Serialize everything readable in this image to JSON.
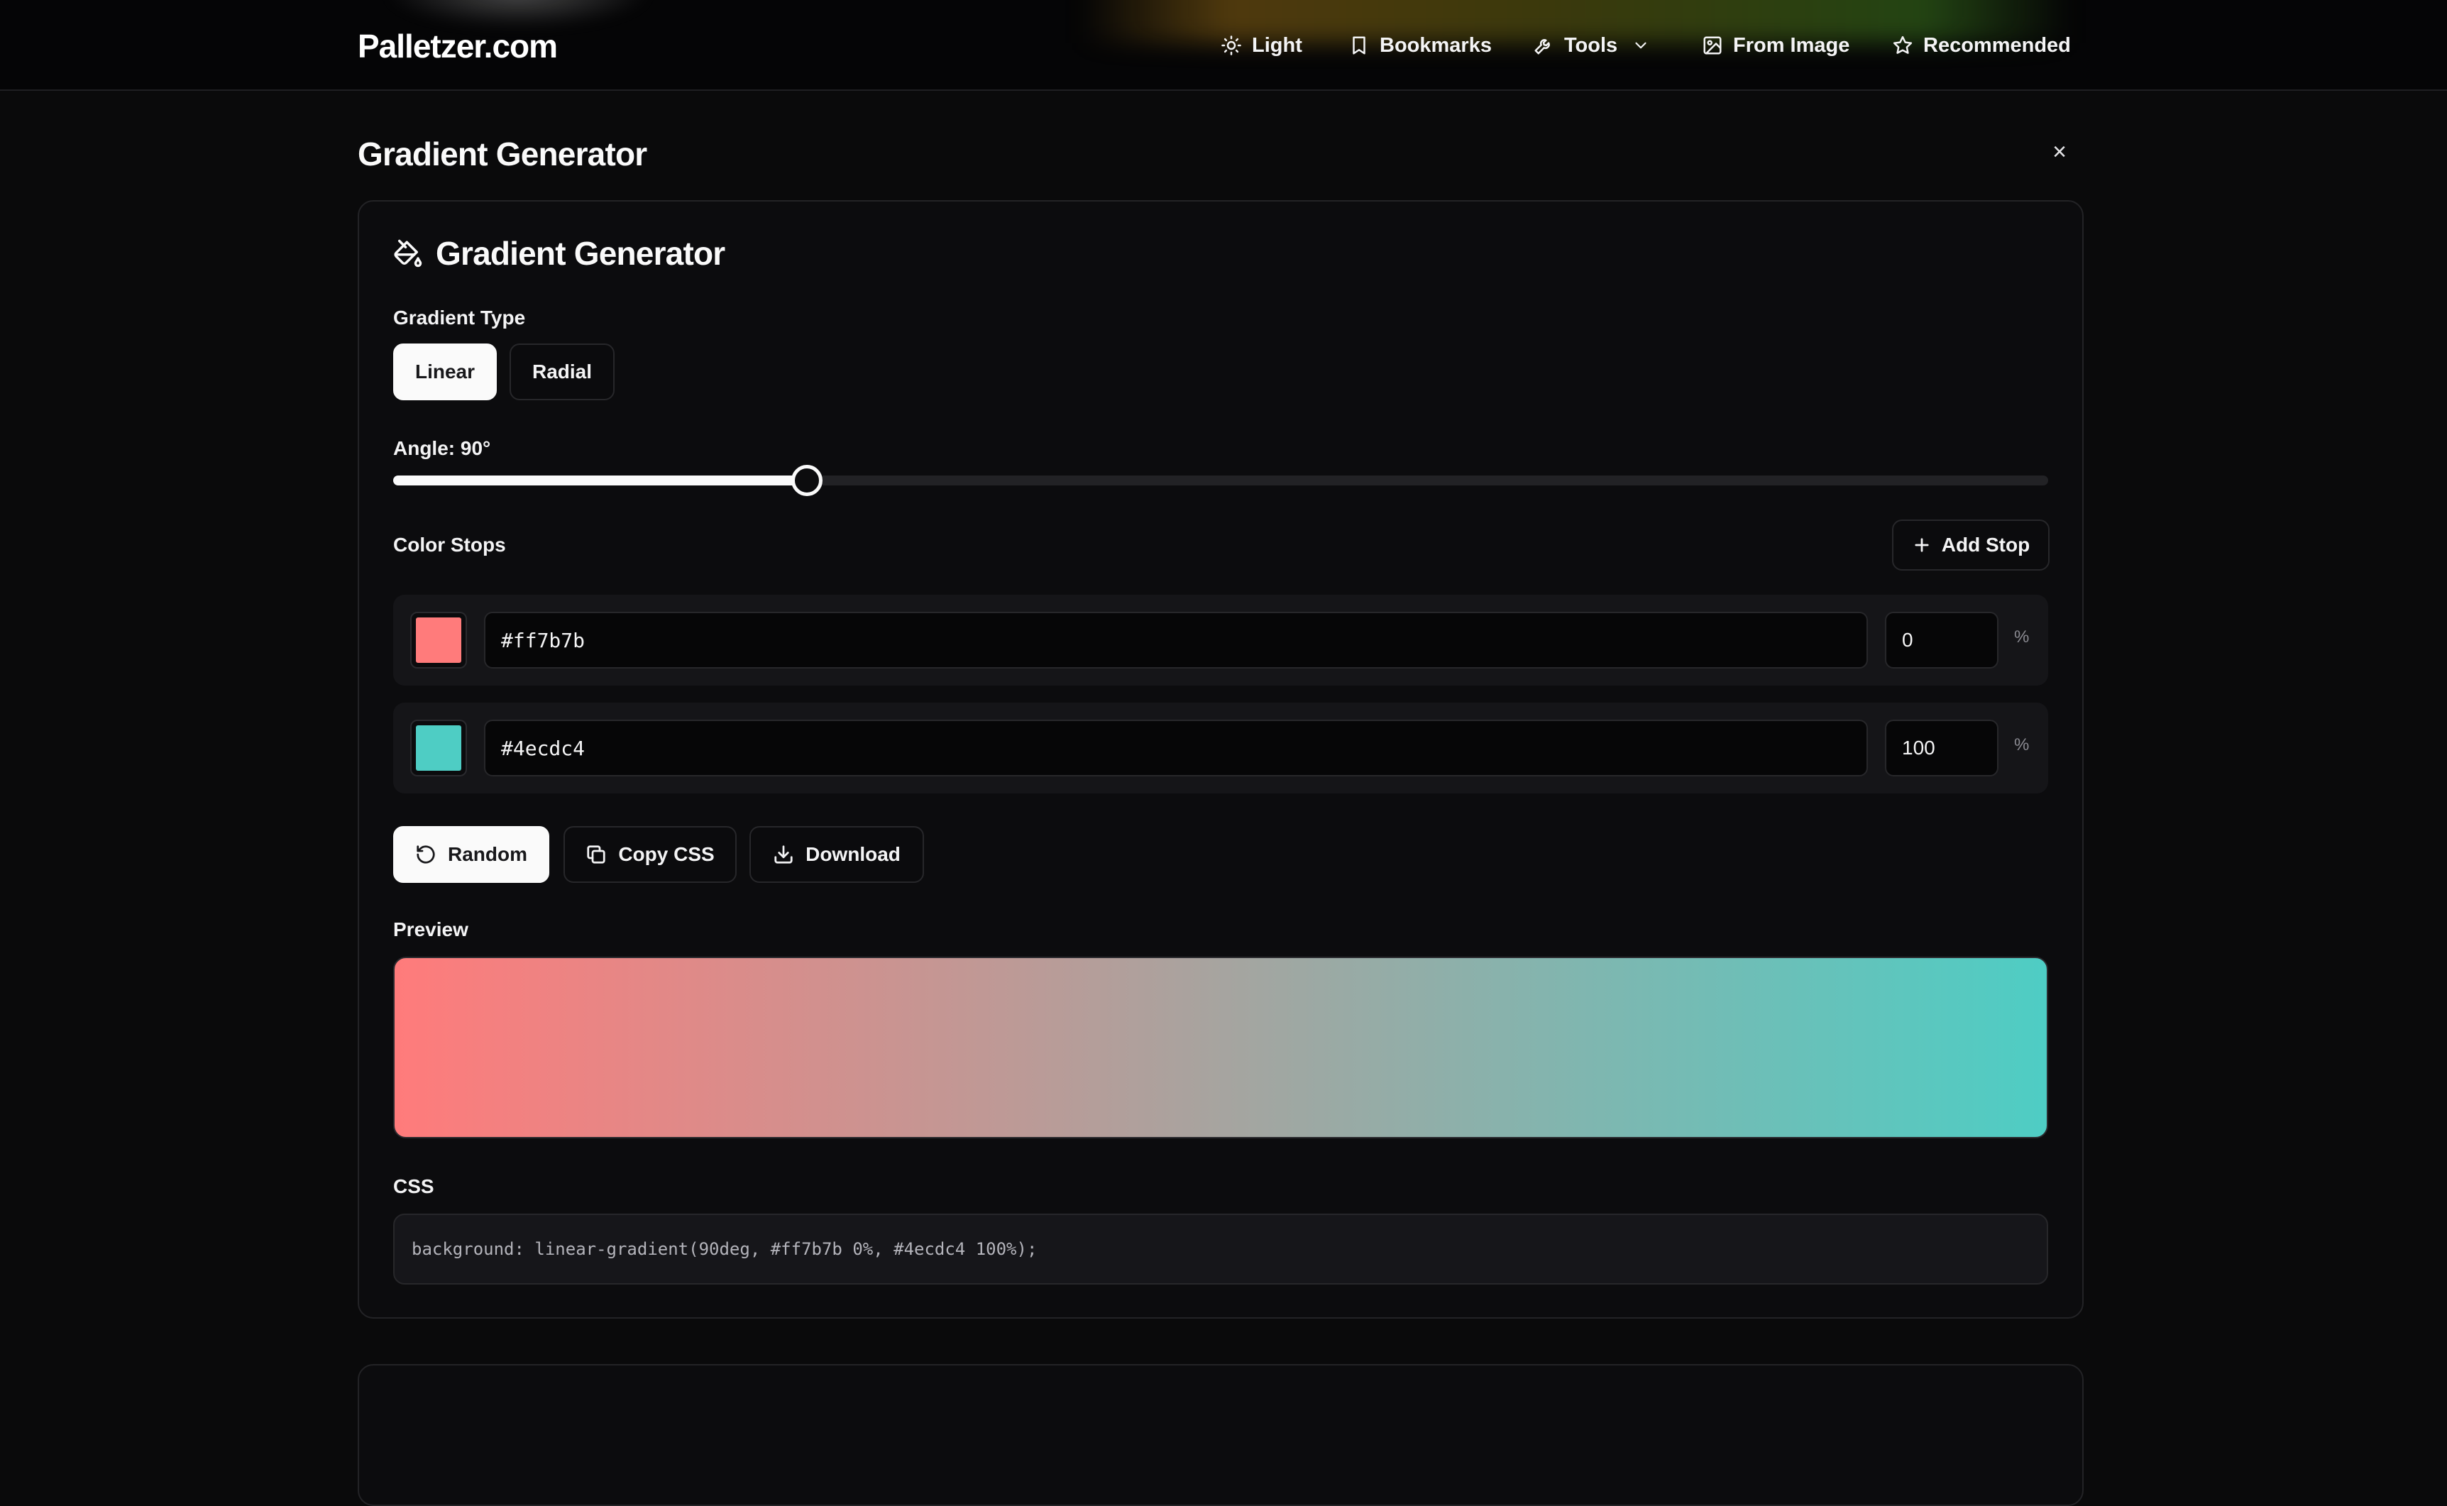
{
  "header": {
    "brand": "Palletzer.com",
    "nav": [
      {
        "label": "Light",
        "icon": "sun-icon"
      },
      {
        "label": "Bookmarks",
        "icon": "bookmark-icon"
      },
      {
        "label": "Tools",
        "icon": "wrench-icon"
      },
      {
        "label": "From Image",
        "icon": "image-icon"
      },
      {
        "label": "Recommended",
        "icon": "star-icon"
      }
    ]
  },
  "page": {
    "title": "Gradient Generator",
    "close_label": "×"
  },
  "generator": {
    "title": "Gradient Generator",
    "title_icon": "paint-bucket-icon",
    "type_label": "Gradient Type",
    "types": [
      {
        "label": "Linear",
        "active": true
      },
      {
        "label": "Radial",
        "active": false
      }
    ],
    "angle_label": "Angle: 90°",
    "angle_value": 90,
    "angle_max": 360,
    "color_stops_label": "Color Stops",
    "add_stop_label": "Add Stop",
    "stops": [
      {
        "color": "#ff7b7b",
        "hex": "#ff7b7b",
        "position": "0",
        "percent_sign": "%"
      },
      {
        "color": "#4ecdc4",
        "hex": "#4ecdc4",
        "position": "100",
        "percent_sign": "%"
      }
    ],
    "actions": {
      "random": "Random",
      "copy_css": "Copy CSS",
      "download": "Download"
    },
    "preview_label": "Preview",
    "css_label": "CSS",
    "css_code": "background: linear-gradient(90deg, #ff7b7b 0%, #4ecdc4 100%);"
  },
  "colors": {
    "background": "#0a0a0b",
    "accent": "#fafafa"
  }
}
